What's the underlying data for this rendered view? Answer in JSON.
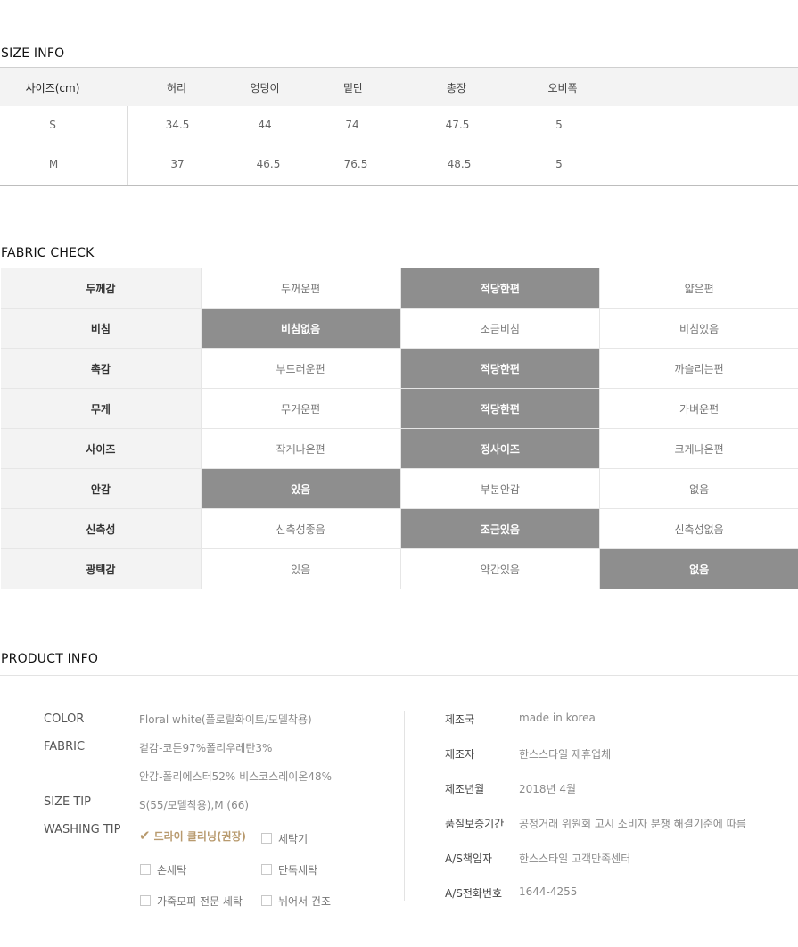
{
  "size_info": {
    "title": "SIZE INFO",
    "headers": [
      "사이즈(cm)",
      "허리",
      "엉덩이",
      "밑단",
      "총장",
      "오비폭"
    ],
    "rows": [
      [
        "S",
        "34.5",
        "44",
        "74",
        "47.5",
        "5"
      ],
      [
        "M",
        "37",
        "46.5",
        "76.5",
        "48.5",
        "5"
      ]
    ]
  },
  "fabric_check": {
    "title": "FABRIC CHECK",
    "rows": [
      {
        "label": "두께감",
        "options": [
          "두꺼운편",
          "적당한편",
          "얇은편"
        ],
        "selected": 1
      },
      {
        "label": "비침",
        "options": [
          "비침없음",
          "조금비침",
          "비침있음"
        ],
        "selected": 0
      },
      {
        "label": "촉감",
        "options": [
          "부드러운편",
          "적당한편",
          "까슬리는편"
        ],
        "selected": 1
      },
      {
        "label": "무게",
        "options": [
          "무거운편",
          "적당한편",
          "가벼운편"
        ],
        "selected": 1
      },
      {
        "label": "사이즈",
        "options": [
          "작게나온편",
          "정사이즈",
          "크게나온편"
        ],
        "selected": 1
      },
      {
        "label": "안감",
        "options": [
          "있음",
          "부분안감",
          "없음"
        ],
        "selected": 0
      },
      {
        "label": "신축성",
        "options": [
          "신축성좋음",
          "조금있음",
          "신축성없음"
        ],
        "selected": 1
      },
      {
        "label": "광택감",
        "options": [
          "있음",
          "약간있음",
          "없음"
        ],
        "selected": 2
      }
    ],
    "selected_color": "#8e8e8e"
  },
  "product_info": {
    "title": "PRODUCT INFO",
    "color_label": "COLOR",
    "color_value": "Floral white(플로랄화이트/모델착용)",
    "fabric_label": "FABRIC",
    "fabric_value_1": "겉감-코튼97%폴리우레탄3%",
    "fabric_value_2": "안감-폴리에스터52% 비스코스레이온48%",
    "size_tip_label": "SIZE TIP",
    "size_tip_value": "S(55/모델착용),M (66)",
    "washing_tip_label": "WASHING TIP",
    "washing": {
      "dry_cleaning": "드라이 클리닝(권장)",
      "machine": "세탁기",
      "hand": "손세탁",
      "separate": "단독세탁",
      "leather": "가죽모피 전문 세탁",
      "flat_dry": "뉘어서 건조"
    },
    "accent_color": "#b89a6e",
    "right": [
      {
        "label": "제조국",
        "value": "made in korea"
      },
      {
        "label": "제조자",
        "value": "한스스타일 제휴업체"
      },
      {
        "label": "제조년월",
        "value": "2018년 4월"
      },
      {
        "label": "품질보증기간",
        "value": "공정거래 위원회 고시 소비자 분쟁 해결기준에 따름"
      },
      {
        "label": "A/S책임자",
        "value": "한스스타일 고객만족센터"
      },
      {
        "label": "A/S전화번호",
        "value": "1644-4255"
      }
    ]
  }
}
